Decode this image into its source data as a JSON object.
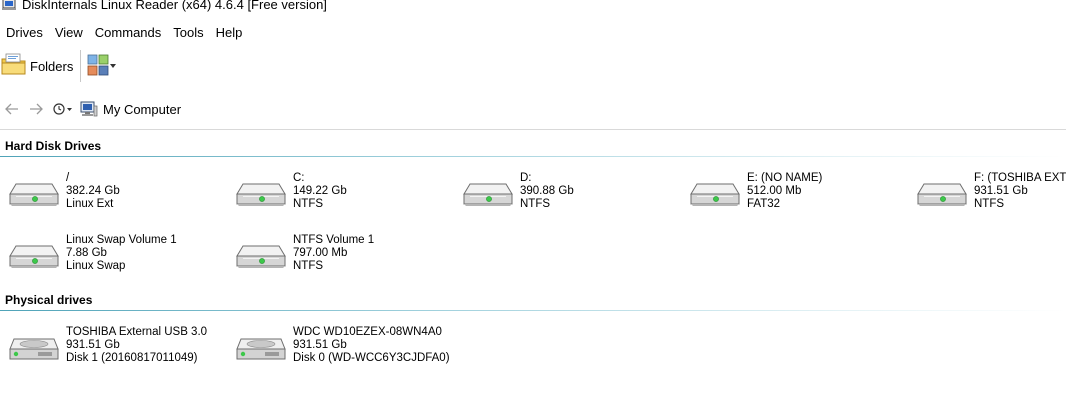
{
  "window": {
    "title": "DiskInternals Linux Reader (x64) 4.6.4 [Free version]"
  },
  "menu": [
    "Drives",
    "View",
    "Commands",
    "Tools",
    "Help"
  ],
  "toolbar": {
    "folders_label": "Folders"
  },
  "address": {
    "location": "My Computer"
  },
  "sections": [
    {
      "title": "Hard Disk Drives",
      "drives": [
        {
          "name": "/",
          "size": "382.24 Gb",
          "fs": "Linux Ext"
        },
        {
          "name": "C:",
          "size": "149.22 Gb",
          "fs": "NTFS"
        },
        {
          "name": "D:",
          "size": "390.88 Gb",
          "fs": "NTFS"
        },
        {
          "name": "E: (NO NAME)",
          "size": "512.00 Mb",
          "fs": "FAT32"
        },
        {
          "name": "F: (TOSHIBA EXT)",
          "size": "931.51 Gb",
          "fs": "NTFS"
        },
        {
          "name": "Linux Swap Volume 1",
          "size": "7.88 Gb",
          "fs": "Linux Swap"
        },
        {
          "name": "NTFS Volume 1",
          "size": "797.00 Mb",
          "fs": "NTFS"
        }
      ]
    },
    {
      "title": "Physical drives",
      "drives": [
        {
          "name": "TOSHIBA External USB 3.0",
          "size": "931.51 Gb",
          "fs": "Disk 1 (20160817011049)"
        },
        {
          "name": "WDC WD10EZEX-08WN4A0",
          "size": "931.51 Gb",
          "fs": "Disk 0 (WD-WCC6Y3CJDFA0)"
        }
      ]
    }
  ],
  "colors": {
    "section_line": "#4fa3b8",
    "led": "#3cc84a"
  }
}
